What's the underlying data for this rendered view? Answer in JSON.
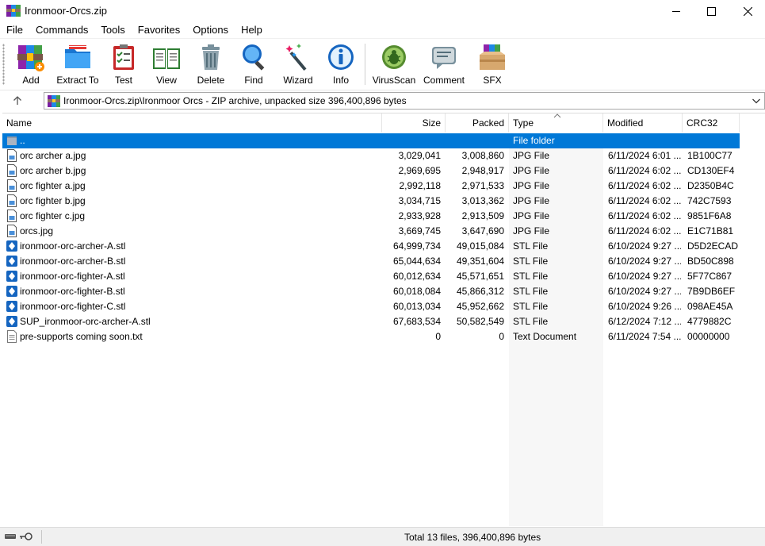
{
  "window": {
    "title": "Ironmoor-Orcs.zip"
  },
  "menu": [
    "File",
    "Commands",
    "Tools",
    "Favorites",
    "Options",
    "Help"
  ],
  "toolbar": {
    "add": "Add",
    "extract": "Extract To",
    "test": "Test",
    "view": "View",
    "delete": "Delete",
    "find": "Find",
    "wizard": "Wizard",
    "info": "Info",
    "virusscan": "VirusScan",
    "comment": "Comment",
    "sfx": "SFX"
  },
  "address": {
    "path": "Ironmoor-Orcs.zip\\Ironmoor Orcs - ZIP archive, unpacked size 396,400,896 bytes"
  },
  "columns": {
    "name": "Name",
    "size": "Size",
    "packed": "Packed",
    "type": "Type",
    "modified": "Modified",
    "crc": "CRC32"
  },
  "files": [
    {
      "name": "..",
      "size": "",
      "packed": "",
      "type": "File folder",
      "modified": "",
      "crc": "",
      "icon": "folder-up-icon",
      "selected": true
    },
    {
      "name": "orc archer a.jpg",
      "size": "3,029,041",
      "packed": "3,008,860",
      "type": "JPG File",
      "modified": "6/11/2024 6:01 ...",
      "crc": "1B100C77",
      "icon": "jpg-file-icon"
    },
    {
      "name": "orc archer b.jpg",
      "size": "2,969,695",
      "packed": "2,948,917",
      "type": "JPG File",
      "modified": "6/11/2024 6:02 ...",
      "crc": "CD130EF4",
      "icon": "jpg-file-icon"
    },
    {
      "name": "orc fighter a.jpg",
      "size": "2,992,118",
      "packed": "2,971,533",
      "type": "JPG File",
      "modified": "6/11/2024 6:02 ...",
      "crc": "D2350B4C",
      "icon": "jpg-file-icon"
    },
    {
      "name": "orc fighter b.jpg",
      "size": "3,034,715",
      "packed": "3,013,362",
      "type": "JPG File",
      "modified": "6/11/2024 6:02 ...",
      "crc": "742C7593",
      "icon": "jpg-file-icon"
    },
    {
      "name": "orc fighter c.jpg",
      "size": "2,933,928",
      "packed": "2,913,509",
      "type": "JPG File",
      "modified": "6/11/2024 6:02 ...",
      "crc": "9851F6A8",
      "icon": "jpg-file-icon"
    },
    {
      "name": "orcs.jpg",
      "size": "3,669,745",
      "packed": "3,647,690",
      "type": "JPG File",
      "modified": "6/11/2024 6:02 ...",
      "crc": "E1C71B81",
      "icon": "jpg-file-icon"
    },
    {
      "name": "ironmoor-orc-archer-A.stl",
      "size": "64,999,734",
      "packed": "49,015,084",
      "type": "STL File",
      "modified": "6/10/2024 9:27 ...",
      "crc": "D5D2ECAD",
      "icon": "stl-file-icon"
    },
    {
      "name": "ironmoor-orc-archer-B.stl",
      "size": "65,044,634",
      "packed": "49,351,604",
      "type": "STL File",
      "modified": "6/10/2024 9:27 ...",
      "crc": "BD50C898",
      "icon": "stl-file-icon"
    },
    {
      "name": "ironmoor-orc-fighter-A.stl",
      "size": "60,012,634",
      "packed": "45,571,651",
      "type": "STL File",
      "modified": "6/10/2024 9:27 ...",
      "crc": "5F77C867",
      "icon": "stl-file-icon"
    },
    {
      "name": "ironmoor-orc-fighter-B.stl",
      "size": "60,018,084",
      "packed": "45,866,312",
      "type": "STL File",
      "modified": "6/10/2024 9:27 ...",
      "crc": "7B9DB6EF",
      "icon": "stl-file-icon"
    },
    {
      "name": "ironmoor-orc-fighter-C.stl",
      "size": "60,013,034",
      "packed": "45,952,662",
      "type": "STL File",
      "modified": "6/10/2024 9:26 ...",
      "crc": "098AE45A",
      "icon": "stl-file-icon"
    },
    {
      "name": "SUP_ironmoor-orc-archer-A.stl",
      "size": "67,683,534",
      "packed": "50,582,549",
      "type": "STL File",
      "modified": "6/12/2024 7:12 ...",
      "crc": "4779882C",
      "icon": "stl-file-icon"
    },
    {
      "name": "pre-supports coming soon.txt",
      "size": "0",
      "packed": "0",
      "type": "Text Document",
      "modified": "6/11/2024 7:54 ...",
      "crc": "00000000",
      "icon": "txt-file-icon"
    }
  ],
  "status": {
    "summary": "Total 13 files, 396,400,896 bytes"
  },
  "colors": {
    "selection": "#0078d7",
    "stl": "#1565c0"
  }
}
